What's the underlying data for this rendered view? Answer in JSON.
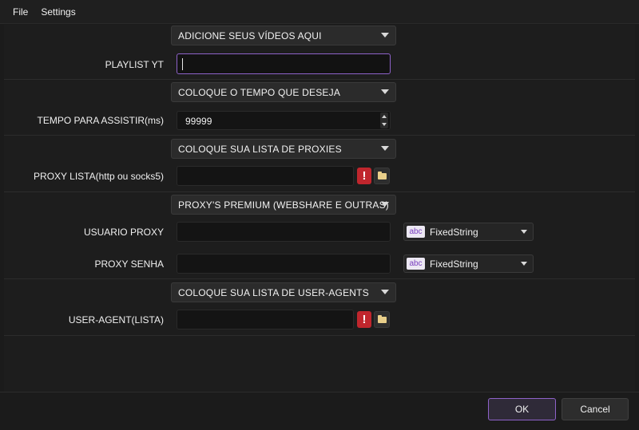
{
  "menu": {
    "file": "File",
    "settings": "Settings"
  },
  "sections": {
    "videos": "ADICIONE SEUS VÍDEOS AQUI",
    "time": "COLOQUE O TEMPO QUE DESEJA",
    "proxies": "COLOQUE SUA LISTA DE PROXIES",
    "premium": "PROXY'S PREMIUM (WEBSHARE E OUTRAS)",
    "useragents": "COLOQUE SUA LISTA DE USER-AGENTS"
  },
  "fields": {
    "playlist": {
      "label": "PLAYLIST YT",
      "value": ""
    },
    "watch_time": {
      "label": "TEMPO PARA ASSISTIR(ms)",
      "value": "99999"
    },
    "proxy_list": {
      "label": "PROXY LISTA(http ou socks5)",
      "value": ""
    },
    "proxy_user": {
      "label": "USUARIO PROXY",
      "value": "",
      "type_label": "FixedString",
      "type_icon": "abc"
    },
    "proxy_pass": {
      "label": "PROXY SENHA",
      "value": "",
      "type_label": "FixedString",
      "type_icon": "abc"
    },
    "user_agent": {
      "label": "USER-AGENT(LISTA)",
      "value": ""
    }
  },
  "warning_glyph": "!",
  "buttons": {
    "ok": "OK",
    "cancel": "Cancel"
  },
  "colors": {
    "accent": "#8e62c9",
    "warning": "#c0262d",
    "folder": "#e9cf8a"
  }
}
